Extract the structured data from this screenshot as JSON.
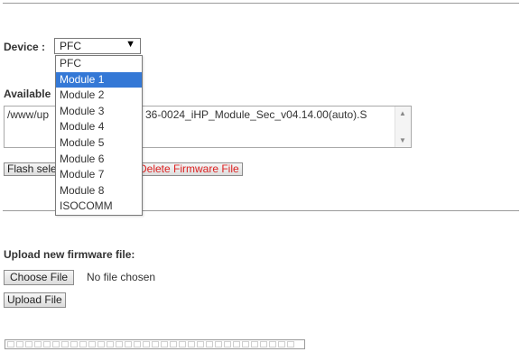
{
  "device": {
    "label": "Device :",
    "selected": "PFC",
    "options": [
      "PFC",
      "Module 1",
      "Module 2",
      "Module 3",
      "Module 4",
      "Module 5",
      "Module 6",
      "Module 7",
      "Module 8",
      "ISOCOMM"
    ],
    "highlighted_index": 1
  },
  "available": {
    "label": "Available",
    "file_left": "/www/up",
    "file_right": "36-0024_iHP_Module_Sec_v04.14.00(auto).S"
  },
  "buttons": {
    "flash_label": "Flash sele",
    "delete_label": "Delete Firmware File"
  },
  "upload": {
    "title": "Upload new firmware file:",
    "choose_label": "Choose File",
    "no_file_text": "No file chosen",
    "upload_label": "Upload File"
  },
  "icons": {
    "select_arrow": "triangle-down-icon",
    "scroll_up": "triangle-up-icon",
    "scroll_down": "triangle-down-icon"
  },
  "progress": {
    "value": 0
  },
  "colors": {
    "highlight": "#3478d6",
    "delete_text": "#d22222"
  }
}
